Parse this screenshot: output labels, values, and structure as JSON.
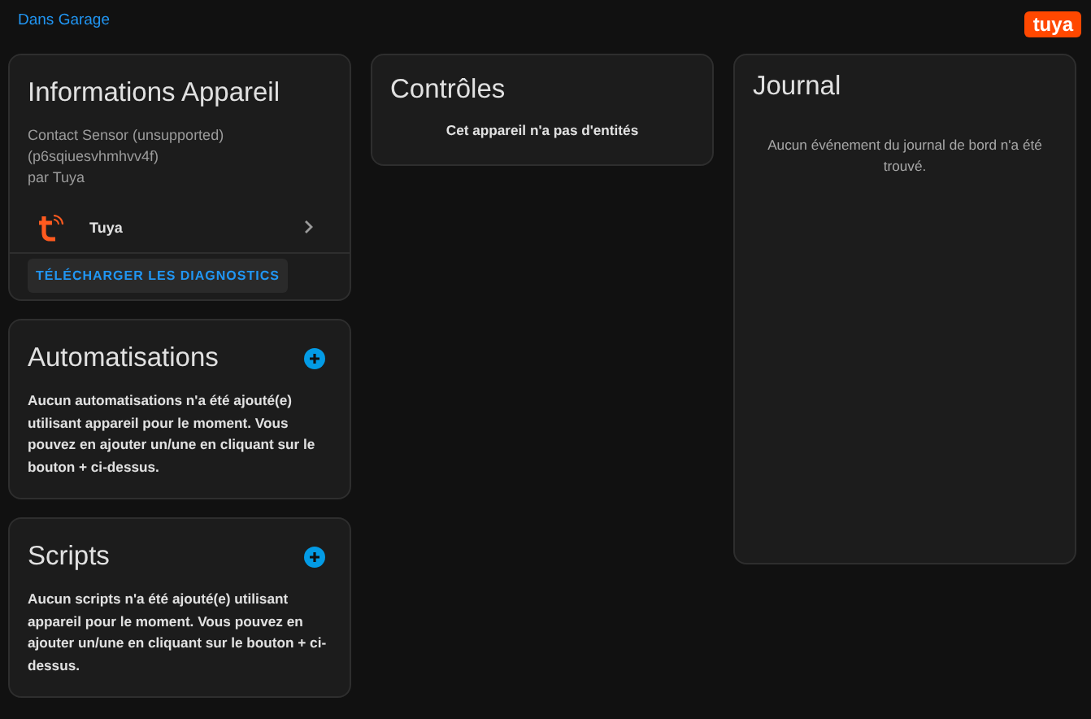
{
  "header": {
    "breadcrumb": "Dans Garage",
    "logo_text": "tuya"
  },
  "device_info": {
    "title": "Informations Appareil",
    "model": "Contact Sensor (unsupported)",
    "model_id": "(p6sqiuesvhmhvv4f)",
    "manufacturer": "par Tuya",
    "integration": "Tuya",
    "diagnostics_button": "TÉLÉCHARGER LES DIAGNOSTICS"
  },
  "automations": {
    "title": "Automatisations",
    "message": "Aucun automatisations n'a été ajouté(e) utilisant appareil pour le moment. Vous pouvez en ajouter un/une en cliquant sur le bouton + ci-dessus."
  },
  "scripts": {
    "title": "Scripts",
    "message": "Aucun scripts n'a été ajouté(e) utilisant appareil pour le moment. Vous pouvez en ajouter un/une en cliquant sur le bouton + ci-dessus."
  },
  "controls": {
    "title": "Contrôles",
    "message": "Cet appareil n'a pas d'entités"
  },
  "logbook": {
    "title": "Journal",
    "message": "Aucun événement du journal de bord n'a été trouvé."
  }
}
